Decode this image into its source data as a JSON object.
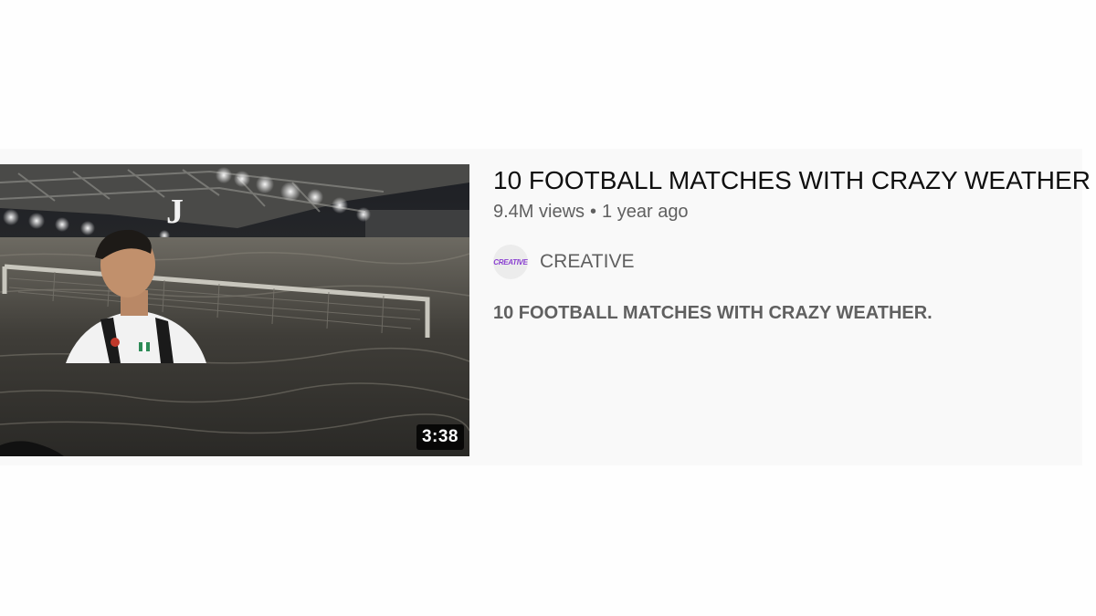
{
  "video": {
    "title": "10 FOOTBALL MATCHES WITH CRAZY WEATHER",
    "views": "9.4M views",
    "separator": "•",
    "age": "1 year ago",
    "duration": "3:38",
    "description": "10 FOOTBALL MATCHES WITH CRAZY WEATHER.",
    "thumbnail": {
      "scene": "football player in flooded stadium at night",
      "crest_letter": "J"
    }
  },
  "channel": {
    "name": "CREATIVE",
    "avatar_text": "CREATIVE"
  },
  "colors": {
    "card_background": "#f9f9f9",
    "title": "#0f0f0f",
    "secondary_text": "#606060",
    "avatar_text": "#8a3fd1"
  }
}
